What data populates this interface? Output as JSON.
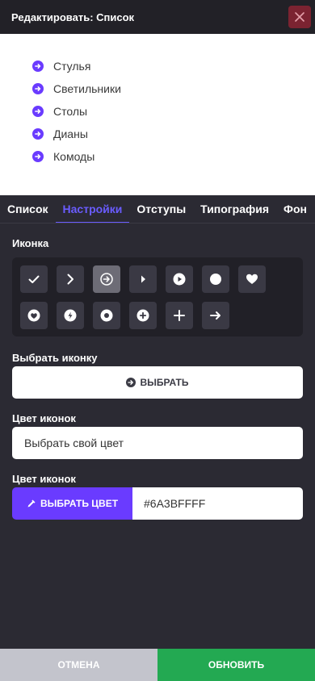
{
  "header": {
    "title": "Редактировать: Список",
    "close_icon": "close-icon"
  },
  "preview": {
    "bullet_icon": "arrow-circle-right-icon",
    "bullet_color": "#6A3BFF",
    "items": [
      {
        "label": "Стулья"
      },
      {
        "label": "Светильники"
      },
      {
        "label": "Столы"
      },
      {
        "label": "Дианы"
      },
      {
        "label": "Комоды"
      }
    ]
  },
  "tabs": [
    {
      "label": "Список"
    },
    {
      "label": "Настройки",
      "active": true
    },
    {
      "label": "Отступы"
    },
    {
      "label": "Типография"
    },
    {
      "label": "Фон"
    }
  ],
  "settings": {
    "icon_label": "Иконка",
    "icons": [
      "check",
      "chevron-right",
      "arrow-circle-right",
      "caret-right",
      "play-circle",
      "circle",
      "heart",
      "heart-circle",
      "bolt-circle",
      "dot-circle",
      "plus-circle",
      "plus",
      "arrow-right"
    ],
    "selected_icon": "arrow-circle-right",
    "choose_icon_label": "Выбрать иконку",
    "choose_button_label": "ВЫБРАТЬ",
    "icon_color_label": "Цвет иконок",
    "color_input_value": "Выбрать свой цвет",
    "icon_color_label_2": "Цвет иконок",
    "pick_color_button_label": "ВЫБРАТЬ ЦВЕТ",
    "hex_value": "#6A3BFFFF",
    "accent_color": "#6A3BFF"
  },
  "footer": {
    "cancel_label": "ОТМЕНА",
    "update_label": "ОБНОВИТЬ",
    "cancel_color": "#c3c4cc",
    "update_color": "#23a952"
  }
}
